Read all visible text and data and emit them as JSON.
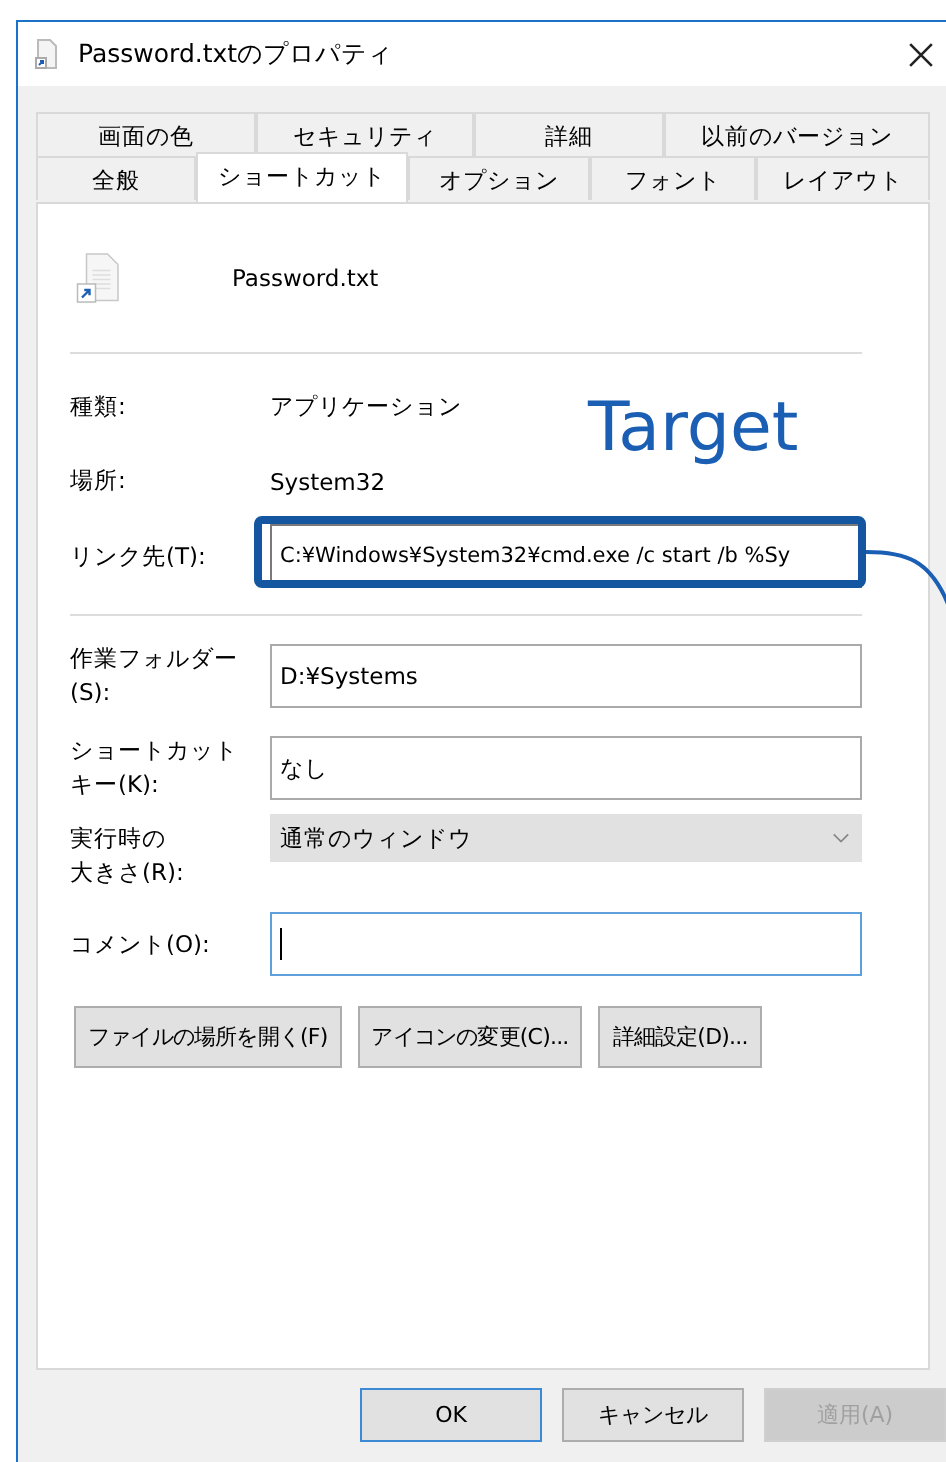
{
  "window": {
    "title": "Password.txtのプロパティ"
  },
  "tabs": [
    [
      {
        "label": "画面の色",
        "selected": false
      },
      {
        "label": "セキュリティ",
        "selected": false
      },
      {
        "label": "詳細",
        "selected": false
      },
      {
        "label": "以前のバージョン",
        "selected": false
      }
    ],
    [
      {
        "label": "全般",
        "selected": false
      },
      {
        "label": "ショートカット",
        "selected": true
      },
      {
        "label": "オプション",
        "selected": false
      },
      {
        "label": "フォント",
        "selected": false
      },
      {
        "label": "レイアウト",
        "selected": false
      }
    ]
  ],
  "file_name": "Password.txt",
  "info": [
    {
      "label": "種類:",
      "value": "アプリケーション"
    },
    {
      "label": "場所:",
      "value": "System32"
    }
  ],
  "target": {
    "label": "リンク先(T):",
    "value": "C:¥Windows¥System32¥cmd.exe /c start /b %Sy",
    "annotation": "Target"
  },
  "fields": [
    {
      "kind": "text",
      "label": [
        "作業フォルダー",
        "(S):"
      ],
      "value": "D:¥Systems"
    },
    {
      "kind": "text",
      "label": [
        "ショートカット",
        "キー(K):"
      ],
      "value": "なし"
    },
    {
      "kind": "select",
      "label": [
        "実行時の",
        "大きさ(R):"
      ],
      "value": "通常のウィンドウ"
    },
    {
      "kind": "focus",
      "label": [
        "コメント(O):"
      ]
    }
  ],
  "actions": [
    "ファイルの場所を開く(F)",
    "アイコンの変更(C)...",
    "詳細設定(D)..."
  ],
  "buttons": [
    {
      "label": "OK",
      "default": true,
      "disabled": false
    },
    {
      "label": "キャンセル",
      "default": false,
      "disabled": false
    },
    {
      "label": "適用(A)",
      "default": false,
      "disabled": true
    }
  ]
}
